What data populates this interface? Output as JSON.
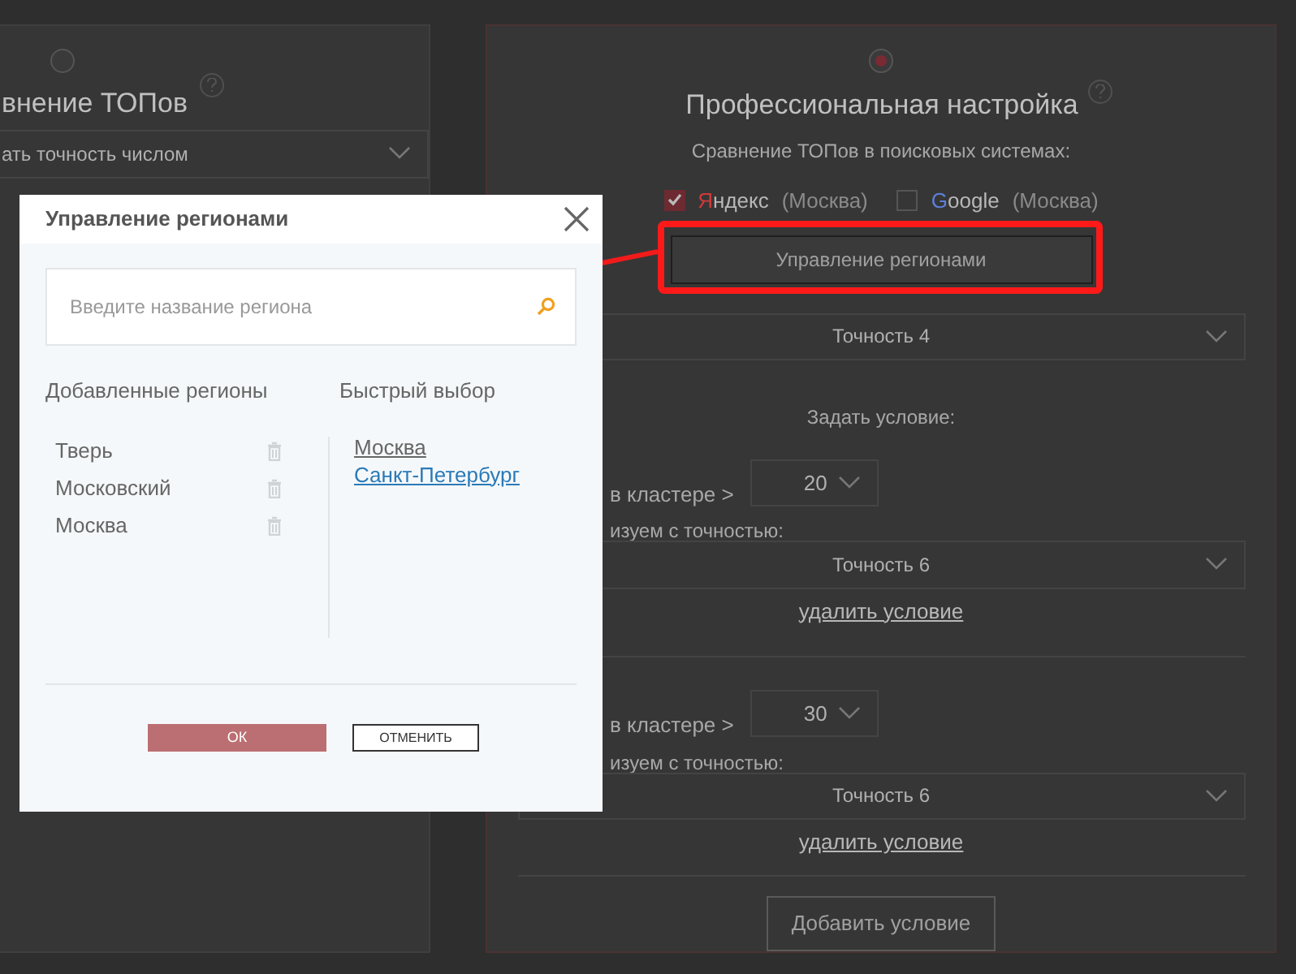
{
  "left_panel": {
    "selected": false,
    "title": "внение ТОПов",
    "select": "ать точность числом"
  },
  "right_panel": {
    "selected": true,
    "title": "Профессиональная настройка",
    "subtitle": "Сравнение ТОПов в поисковых системах:",
    "engines": [
      {
        "name": "Яндекс",
        "region": "(Москва)",
        "checked": true,
        "color": "#d23a3a"
      },
      {
        "name": "Google",
        "region": "(Москва)",
        "checked": false,
        "color": "#5b80d8"
      }
    ],
    "regions_button": {
      "label": "Управление регионами",
      "highlighted": true
    },
    "accuracy_select": "Точность 4",
    "conditions_label": "Задать условие:",
    "conditions": [
      {
        "cluster_label": "в кластере >",
        "count": "20",
        "accuracy_label": "изуем с точностью:",
        "accuracy": "Точность 6",
        "remove": "удалить условие"
      },
      {
        "cluster_label": "в кластере >",
        "count": "30",
        "accuracy_label": "изуем с точностью:",
        "accuracy": "Точность 6",
        "remove": "удалить условие"
      }
    ],
    "add_button": "Добавить условие"
  },
  "dialog": {
    "title": "Управление регионами",
    "search": {
      "placeholder": "Введите название региона"
    },
    "added_title": "Добавленные регионы",
    "added_regions": [
      "Тверь",
      "Московский",
      "Москва"
    ],
    "quick_title": "Быстрый выбор",
    "quick_regions": [
      {
        "label": "Москва",
        "color": "#666666"
      },
      {
        "label": "Санкт-Петербург",
        "color": "#2a7ab8"
      }
    ],
    "buttons": [
      {
        "label": "ОК",
        "kind": "primary"
      },
      {
        "label": "ОТМЕНИТЬ",
        "kind": "secondary"
      }
    ]
  }
}
